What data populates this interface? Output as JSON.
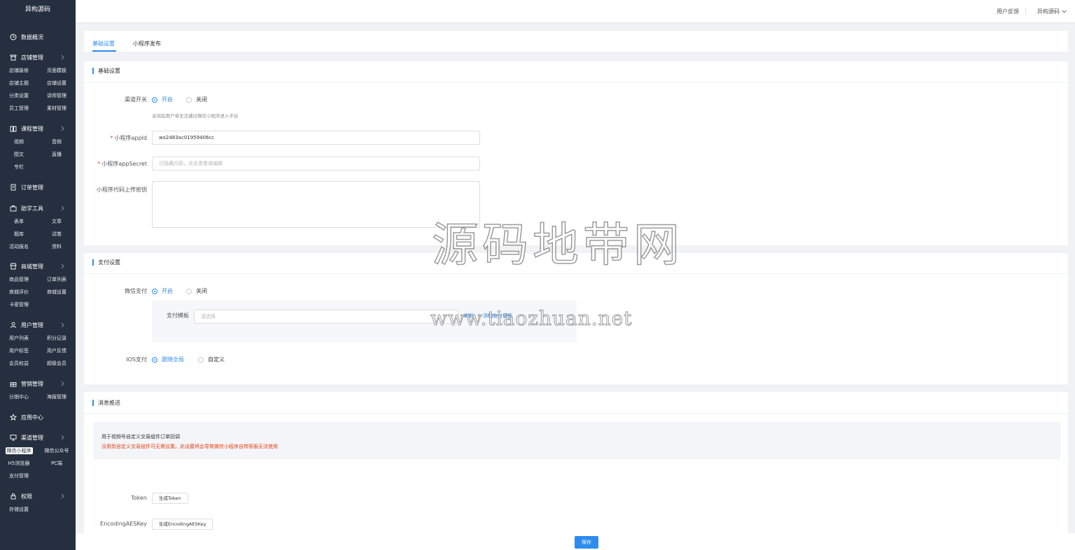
{
  "sidebar": {
    "brand": "异构源码",
    "groups": [
      {
        "title": "数据概况",
        "icon": "clock-icon",
        "items": []
      },
      {
        "title": "店铺管理",
        "icon": "store-icon",
        "items": [
          "店铺装修",
          "页面模板",
          "店铺主题",
          "店铺设置",
          "分类设置",
          "讲师管理",
          "员工管理",
          "素材管理"
        ]
      },
      {
        "title": "课程管理",
        "icon": "book-icon",
        "items": [
          "视频",
          "音频",
          "图文",
          "直播",
          "专栏"
        ]
      },
      {
        "title": "订单管理",
        "icon": "document-icon",
        "items": []
      },
      {
        "title": "助学工具",
        "icon": "briefcase-icon",
        "items": [
          "表单",
          "文章",
          "题库",
          "试卷",
          "活动报名",
          "资料"
        ]
      },
      {
        "title": "商城管理",
        "icon": "shop-icon",
        "items": [
          "商品管理",
          "订单列表",
          "商城评价",
          "商城设置",
          "卡密管理"
        ]
      },
      {
        "title": "用户管理",
        "icon": "user-icon",
        "items": [
          "用户列表",
          "积分记录",
          "用户标签",
          "用户反馈",
          "会员权益",
          "超级会员"
        ]
      },
      {
        "title": "营销管理",
        "icon": "gift-icon",
        "items": [
          "分销中心",
          "海报管理"
        ]
      },
      {
        "title": "应用中心",
        "icon": "star-icon",
        "items": []
      },
      {
        "title": "渠道管理",
        "icon": "monitor-icon",
        "items": [
          "微信小程序",
          "微信公众号",
          "H5浏览器",
          "PC端",
          "支付管理"
        ]
      },
      {
        "title": "权限",
        "icon": "lock-icon",
        "items": [
          "存储设置"
        ]
      }
    ],
    "active_item": "微信小程序"
  },
  "header": {
    "feedback": "用户反馈",
    "user": "异构源码"
  },
  "tabs": [
    "基础设置",
    "小程序发布"
  ],
  "basic": {
    "title": "基础设置",
    "channel_label": "渠道开关",
    "on": "开启",
    "off": "关闭",
    "channel_hint": "关闭后用户将无法通过微信小程序进入平台",
    "appid_label": "小程序appId",
    "appid_value": "wx2483ac01959406cc",
    "secret_label": "小程序appSecret",
    "secret_placeholder": "已隐藏内容，点击查看或编辑",
    "upload_key_label": "小程序代码上传密钥"
  },
  "payment": {
    "title": "支付设置",
    "wechat_label": "微信支付",
    "on": "开启",
    "off": "关闭",
    "template_label": "支付模板",
    "template_placeholder": "请选择",
    "refresh": "刷新",
    "add_template": "添加支付模板",
    "ios_label": "IOS支付",
    "ios_follow": "跟随全局",
    "ios_custom": "自定义"
  },
  "message": {
    "title": "消息推送",
    "notice_line1": "用于视频号自定义交易组件订单回调",
    "notice_line2": "没用到自定义交易组件可无需设置。此设置将会导致微信小程序自带客服无法使用",
    "token_label": "Token",
    "token_button": "生成Token",
    "aes_label": "EncodingAESKey",
    "aes_button": "生成EncodingAESKey"
  },
  "save_button": "保存",
  "watermark": {
    "title": "源码地带网",
    "url": "www.tiaozhuan.net"
  },
  "colors": {
    "sidebar_bg": "#252f3f",
    "accent": "#2d8cf0",
    "danger": "#ed4014"
  }
}
